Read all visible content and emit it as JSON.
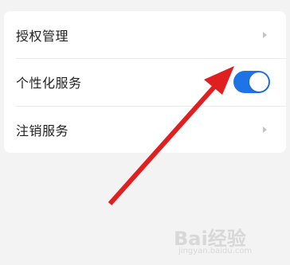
{
  "settings": {
    "items": [
      {
        "label": "授权管理",
        "control": "chevron"
      },
      {
        "label": "个性化服务",
        "control": "toggle",
        "toggle_on": true
      },
      {
        "label": "注销服务",
        "control": "chevron"
      }
    ]
  },
  "colors": {
    "background": "#f3f3f3",
    "card": "#ffffff",
    "toggle_on": "#1e74e6",
    "annotation_arrow": "#e02020"
  },
  "watermark": {
    "brand": "Bai经验",
    "site": "jingyan.baidu.com"
  }
}
